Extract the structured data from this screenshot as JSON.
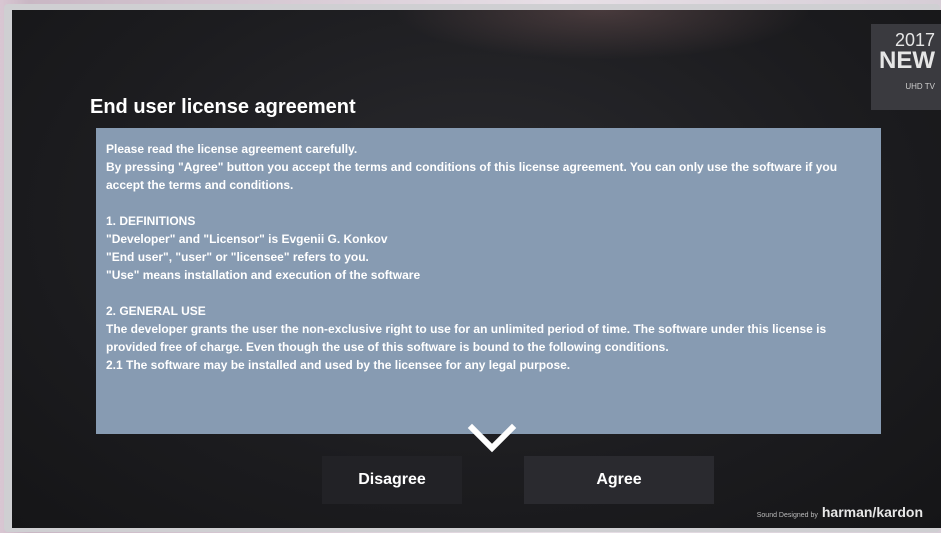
{
  "badge": {
    "year": "2017",
    "new": "NEW",
    "sub": "UHD TV"
  },
  "dialog": {
    "title": "End user license agreement",
    "license_paragraphs": [
      "Please read the license agreement carefully.",
      "By pressing \"Agree\" button you accept the terms and conditions of this license agreement. You can only use the software if you accept the terms and conditions.",
      "",
      "1. DEFINITIONS",
      "\"Developer\" and \"Licensor\" is Evgenii G. Konkov",
      "\"End user\", \"user\" or \"licensee\" refers to you.",
      "\"Use\" means installation and execution of the software",
      "",
      "2. GENERAL USE",
      "The developer grants the user the non-exclusive right to use for an unlimited period of time. The software under this license is provided free of charge. Even though the use of this software is bound to the following conditions.",
      "2.1 The software may be installed and used by the licensee for any legal purpose."
    ],
    "buttons": {
      "disagree": "Disagree",
      "agree": "Agree"
    }
  },
  "footer": {
    "sound_designed_by": "Sound Designed by",
    "brand": "harman/kardon"
  }
}
